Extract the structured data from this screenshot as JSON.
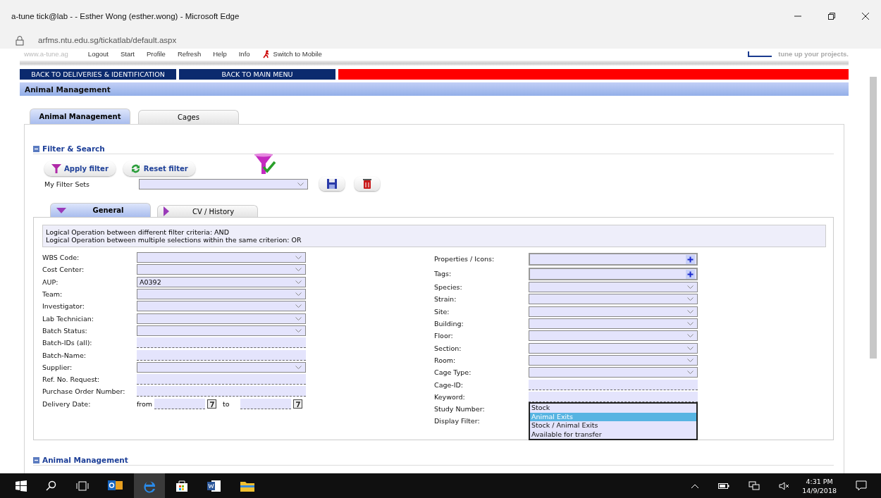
{
  "window": {
    "title": "a-tune tick@lab - - Esther Wong (esther.wong) - Microsoft Edge"
  },
  "address_bar": {
    "url": "arfms.ntu.edu.sg/tickatlab/default.aspx"
  },
  "top_nav": {
    "site": "www.a-tune.ag",
    "links": [
      "Logout",
      "Start",
      "Profile",
      "Refresh",
      "Help",
      "Info"
    ],
    "mobile": "Switch to Mobile",
    "tagline": "tune up your projects."
  },
  "nav_buttons": [
    "BACK TO DELIVERIES & IDENTIFICATION",
    "BACK TO MAIN MENU"
  ],
  "section_title": "Animal Management",
  "tabs": [
    {
      "label": "Animal Management",
      "selected": true
    },
    {
      "label": "Cages",
      "selected": false
    }
  ],
  "filter": {
    "title": "Filter & Search",
    "buttons": [
      {
        "label": "Apply filter",
        "kind": "apply"
      },
      {
        "label": "Reset filter",
        "kind": "reset"
      }
    ],
    "filter_sets_label": "My Filter Sets"
  },
  "subtabs": [
    {
      "label": "General",
      "selected": true
    },
    {
      "label": "CV / History",
      "selected": false
    }
  ],
  "info_lines": [
    "Logical Operation between different filter criteria: AND",
    "Logical Operation between multiple selections within the same criterion: OR"
  ],
  "left_fields": [
    {
      "label": "WBS Code:",
      "kind": "select"
    },
    {
      "label": "Cost Center:",
      "kind": "select"
    },
    {
      "label": "AUP:",
      "kind": "select",
      "value": "A0392"
    },
    {
      "label": "Team:",
      "kind": "select"
    },
    {
      "label": "Investigator:",
      "kind": "select"
    },
    {
      "label": "Lab Technician:",
      "kind": "select"
    },
    {
      "label": "Batch Status:",
      "kind": "select"
    },
    {
      "label": "Batch-IDs (all):",
      "kind": "text"
    },
    {
      "label": "Batch-Name:",
      "kind": "text"
    },
    {
      "label": "Supplier:",
      "kind": "select"
    },
    {
      "label": "Ref. No. Request:",
      "kind": "text"
    },
    {
      "label": "Purchase Order Number:",
      "kind": "text"
    },
    {
      "label": "Delivery Date:",
      "kind": "date_range",
      "from_label": "from",
      "to_label": "to"
    }
  ],
  "right_fields": [
    {
      "label": "Properties / Icons:",
      "kind": "plus"
    },
    {
      "label": "Tags:",
      "kind": "plus"
    },
    {
      "label": "Species:",
      "kind": "select"
    },
    {
      "label": "Strain:",
      "kind": "select"
    },
    {
      "label": "Site:",
      "kind": "select"
    },
    {
      "label": "Building:",
      "kind": "select"
    },
    {
      "label": "Floor:",
      "kind": "select"
    },
    {
      "label": "Section:",
      "kind": "select"
    },
    {
      "label": "Room:",
      "kind": "select"
    },
    {
      "label": "Cage Type:",
      "kind": "select"
    },
    {
      "label": "Cage-ID:",
      "kind": "text"
    },
    {
      "label": "Keyword:",
      "kind": "text"
    },
    {
      "label": "Study Number:",
      "kind": "covered"
    },
    {
      "label": "Display Filter:",
      "kind": "listbox",
      "options": [
        {
          "label": "Stock",
          "selected": false
        },
        {
          "label": "Animal Exits",
          "selected": true
        },
        {
          "label": "Stock / Animal Exits",
          "selected": false
        },
        {
          "label": "Available for transfer",
          "selected": false
        }
      ]
    }
  ],
  "section2_title": "Animal Management",
  "taskbar": {
    "time": "4:31 PM",
    "date": "14/9/2018"
  }
}
